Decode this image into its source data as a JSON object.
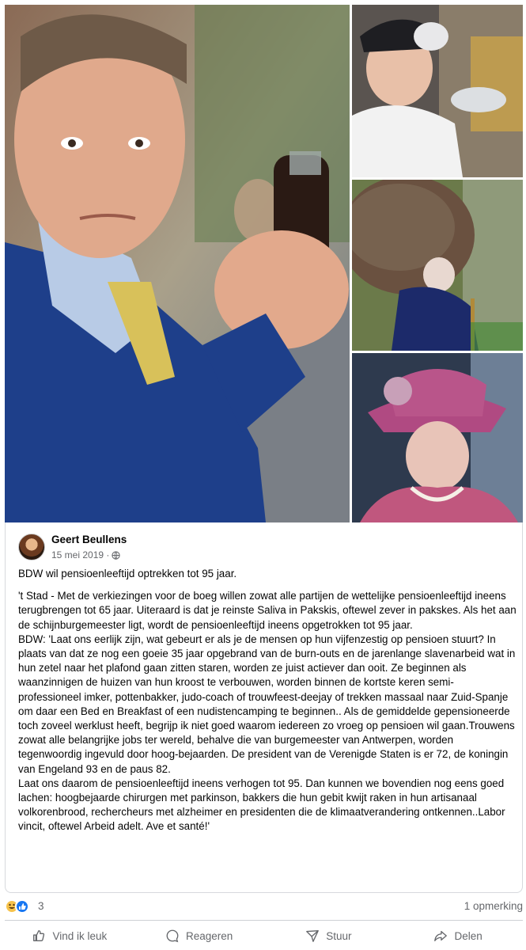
{
  "photos": {
    "main": "man-with-bottle-photo",
    "side": [
      "elderly-fastfood-worker-photo",
      "elderly-woman-firewood-photo",
      "queen-pink-hat-photo"
    ]
  },
  "post": {
    "author": "Geert Beullens",
    "date": "15 mei 2019 · ",
    "privacy_icon": "globe-icon",
    "headline": "BDW wil pensioenleeftijd optrekken tot 95 jaar.",
    "paragraph1": "'t Stad - Met de verkiezingen voor de boeg willen zowat alle partijen de wettelijke pensioenleeftijd ineens terugbrengen tot 65 jaar.  Uiteraard is dat je reinste Saliva in Pakskis, oftewel zever in pakskes. Als het aan de schijnburgemeester ligt, wordt de pensioenleeftijd ineens opgetrokken tot 95 jaar.",
    "paragraph2": "BDW: 'Laat ons eerlijk zijn, wat gebeurt er als je de mensen op hun vijfenzestig op pensioen stuurt? In plaats van dat ze nog een goeie 35 jaar opgebrand van de burn-outs en de jarenlange slavenarbeid wat in hun zetel naar het plafond gaan zitten staren, worden ze juist actiever dan ooit. Ze beginnen als waanzinnigen de huizen van hun kroost te verbouwen, worden binnen de kortste keren semi-professioneel imker, pottenbakker, judo-coach of trouwfeest-deejay of trekken massaal naar Zuid-Spanje om daar een Bed en Breakfast of een nudistencamping te beginnen.. Als de gemiddelde gepensioneerde toch zoveel werklust heeft, begrijp ik niet goed waarom iedereen zo vroeg op pensioen wil gaan.Trouwens zowat alle belangrijke jobs ter wereld, behalve die van burgemeester van Antwerpen, worden tegenwoordig ingevuld door hoog-bejaarden. De president van de Verenigde Staten is er 72, de koningin van Engeland 93 en de paus 82.",
    "paragraph3": "Laat ons daarom de pensioenleeftijd ineens verhogen tot 95. Dan kunnen we bovendien nog eens goed lachen: hoogbejaarde chirurgen met parkinson, bakkers die hun gebit kwijt raken in hun artisanaal volkorenbrood, rechercheurs met alzheimer en presidenten die de klimaatverandering ontkennen..Labor vincit, oftewel Arbeid adelt. Ave et santé!'"
  },
  "reactions": {
    "icons": [
      "haha-icon",
      "like-icon"
    ],
    "count": "3",
    "comments": "1 opmerking"
  },
  "actions": {
    "like": "Vind ik leuk",
    "comment": "Reageren",
    "send": "Stuur",
    "share": "Delen"
  },
  "colors": {
    "text": "#050505",
    "muted": "#65676b",
    "like_blue": "#1877f2",
    "haha_yellow": "#f7c34b",
    "border": "#ced0d4"
  }
}
